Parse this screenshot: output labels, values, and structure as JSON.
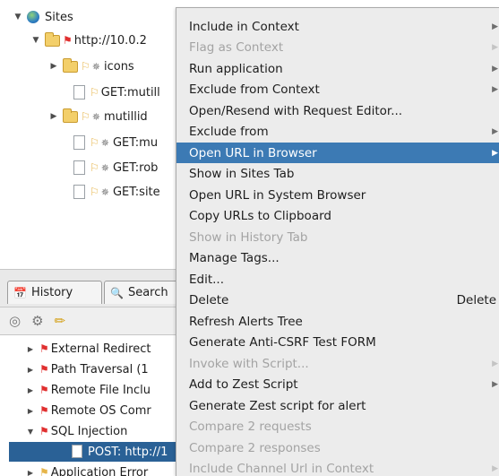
{
  "sites_tree": {
    "root_label": "Sites",
    "items": [
      {
        "label": "http://10.0.2",
        "kind": "folder"
      },
      {
        "label": "icons",
        "kind": "folder"
      },
      {
        "label": "GET:mutill",
        "kind": "doc"
      },
      {
        "label": "mutillid",
        "kind": "folder"
      },
      {
        "label": "GET:mu",
        "kind": "doc"
      },
      {
        "label": "GET:rob",
        "kind": "doc"
      },
      {
        "label": "GET:site",
        "kind": "doc"
      }
    ]
  },
  "tabs": [
    {
      "label": "History",
      "icon": "calendar-icon"
    },
    {
      "label": "Search",
      "icon": "magnifier-icon"
    }
  ],
  "toolbar_icons": [
    "target-icon",
    "gear-icon",
    "pencil-icon"
  ],
  "alerts_tree": {
    "items": [
      {
        "label": "External Redirect",
        "expanded": false
      },
      {
        "label": "Path Traversal (1",
        "expanded": false
      },
      {
        "label": "Remote File Inclu",
        "expanded": false
      },
      {
        "label": "Remote OS Comr",
        "expanded": false
      },
      {
        "label": "SQL Injection",
        "expanded": true
      },
      {
        "label": "POST: http://1",
        "selected": true
      },
      {
        "label": "Application Error",
        "expanded": false
      }
    ]
  },
  "context_menu": {
    "items": [
      {
        "label": "Include in Context",
        "enabled": true,
        "submenu": true
      },
      {
        "label": "Flag as Context",
        "enabled": false,
        "submenu": true
      },
      {
        "label": "Run application",
        "enabled": true,
        "submenu": true
      },
      {
        "label": "Exclude from Context",
        "enabled": true,
        "submenu": true
      },
      {
        "label": "Open/Resend with Request Editor...",
        "enabled": true,
        "submenu": false
      },
      {
        "label": "Exclude from",
        "enabled": true,
        "submenu": true
      },
      {
        "label": "Open URL in Browser",
        "enabled": true,
        "submenu": true,
        "highlighted": true
      },
      {
        "label": "Show in Sites Tab",
        "enabled": true,
        "submenu": false
      },
      {
        "label": "Open URL in System Browser",
        "enabled": true,
        "submenu": false
      },
      {
        "label": "Copy URLs to Clipboard",
        "enabled": true,
        "submenu": false
      },
      {
        "label": "Show in History Tab",
        "enabled": false,
        "submenu": false
      },
      {
        "label": "Manage Tags...",
        "enabled": true,
        "submenu": false
      },
      {
        "label": "Edit...",
        "enabled": true,
        "submenu": false
      },
      {
        "label": "Delete",
        "enabled": true,
        "submenu": false,
        "accelerator": "Delete"
      },
      {
        "label": "Refresh Alerts Tree",
        "enabled": true,
        "submenu": false
      },
      {
        "label": "Generate Anti-CSRF Test FORM",
        "enabled": true,
        "submenu": false
      },
      {
        "label": "Invoke with Script...",
        "enabled": false,
        "submenu": true
      },
      {
        "label": "Add to Zest Script",
        "enabled": true,
        "submenu": true
      },
      {
        "label": "Generate Zest script for alert",
        "enabled": true,
        "submenu": false
      },
      {
        "label": "Compare 2 requests",
        "enabled": false,
        "submenu": false
      },
      {
        "label": "Compare 2 responses",
        "enabled": false,
        "submenu": false
      },
      {
        "label": "Include Channel Url in Context",
        "enabled": false,
        "submenu": true
      }
    ]
  },
  "colors": {
    "menu_bg": "#ececec",
    "highlight": "#3c7ab4",
    "selected_row": "#2a6196",
    "disabled_text": "#a3a3a3",
    "flag_red": "#e03030"
  }
}
